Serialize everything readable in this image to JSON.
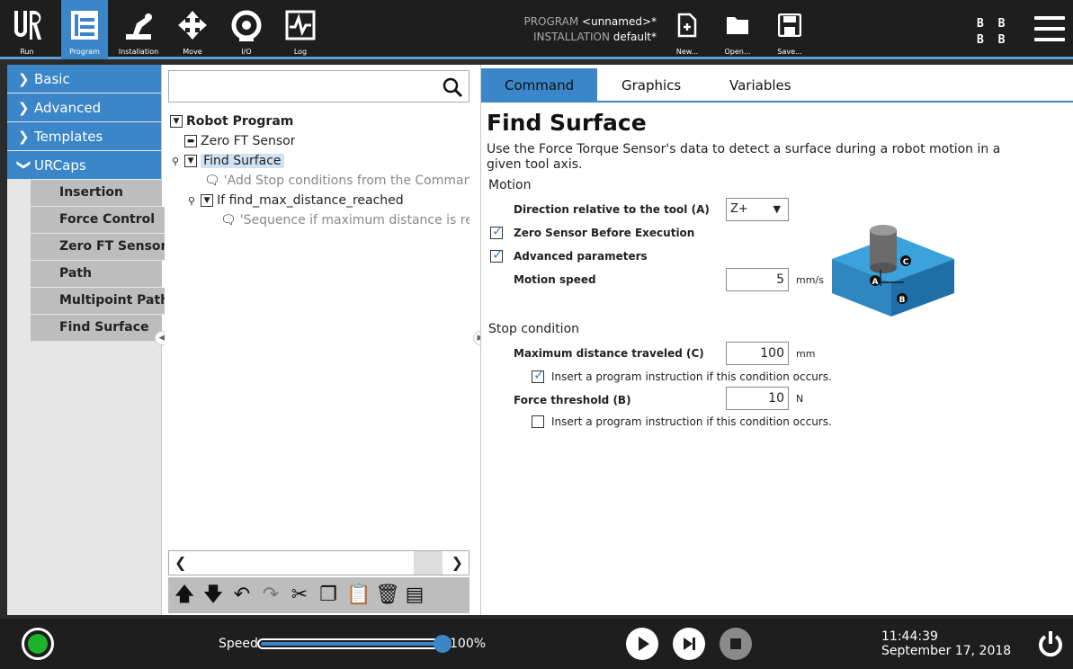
{
  "topbar": {
    "tabs": [
      {
        "label": "Run",
        "icon": "ur-logo-icon"
      },
      {
        "label": "Program",
        "icon": "program-icon"
      },
      {
        "label": "Installation",
        "icon": "installation-icon"
      },
      {
        "label": "Move",
        "icon": "move-icon"
      },
      {
        "label": "I/O",
        "icon": "io-icon"
      },
      {
        "label": "Log",
        "icon": "log-icon"
      }
    ],
    "active_tab": "Program",
    "program_label": "PROGRAM",
    "program_value": "<unnamed>*",
    "installation_label": "INSTALLATION",
    "installation_value": "default*",
    "file_buttons": [
      {
        "label": "New...",
        "icon": "new-file-icon"
      },
      {
        "label": "Open...",
        "icon": "folder-icon"
      },
      {
        "label": "Save...",
        "icon": "save-icon"
      }
    ],
    "status_letters": [
      "B B",
      "B B"
    ]
  },
  "sidebar": {
    "categories": [
      {
        "label": "Basic",
        "expanded": false
      },
      {
        "label": "Advanced",
        "expanded": false
      },
      {
        "label": "Templates",
        "expanded": false
      },
      {
        "label": "URCaps",
        "expanded": true
      }
    ],
    "urcaps_items": [
      "Insertion",
      "Force Control",
      "Zero FT Sensor",
      "Path",
      "Multipoint Path",
      "Find Surface"
    ]
  },
  "tree": {
    "root": "Robot Program",
    "items": [
      {
        "label": "Zero FT Sensor"
      },
      {
        "label": "Find Surface",
        "selected": true
      },
      {
        "label": "'Add Stop conditions from the Command tab"
      },
      {
        "label": "If find_max_distance_reached"
      },
      {
        "label": "'Sequence if maximum distance is reached"
      }
    ]
  },
  "editor": {
    "tabs": [
      "Command",
      "Graphics",
      "Variables"
    ],
    "active_tab": "Command",
    "title": "Find Surface",
    "description": "Use the Force Torque Sensor's data to detect a surface during a robot motion in a given tool axis.",
    "motion_heading": "Motion",
    "direction_label": "Direction relative to the tool (A)",
    "direction_value": "Z+",
    "zero_sensor_label": "Zero Sensor Before Execution",
    "zero_sensor_checked": true,
    "advanced_label": "Advanced parameters",
    "advanced_checked": true,
    "motion_speed_label": "Motion speed",
    "motion_speed_value": "5",
    "motion_speed_unit": "mm/s",
    "stop_heading": "Stop condition",
    "max_distance_label": "Maximum distance traveled (C)",
    "max_distance_value": "100",
    "max_distance_unit": "mm",
    "max_distance_insert_label": "Insert a program instruction if this condition occurs.",
    "max_distance_insert_checked": true,
    "force_label": "Force threshold (B)",
    "force_value": "10",
    "force_unit": "N",
    "force_insert_label": "Insert a program instruction if this condition occurs.",
    "force_insert_checked": false,
    "diagram_labels": [
      "A",
      "B",
      "C"
    ]
  },
  "bottombar": {
    "speed_label": "Speed",
    "speed_value": "100%",
    "speed_fraction": 1.0,
    "time": "11:44:39",
    "date": "September 17, 2018"
  },
  "colors": {
    "accent": "#3a86c8",
    "bar": "#1e1e1e",
    "status_green": "#1db32a"
  }
}
